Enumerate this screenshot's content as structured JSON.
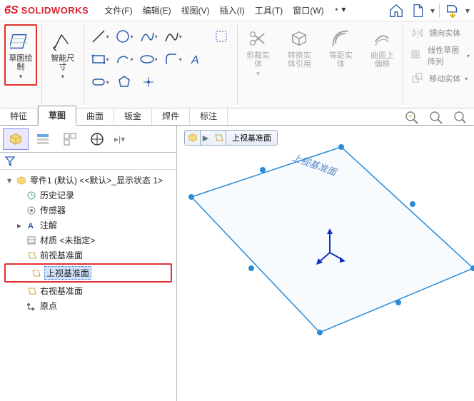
{
  "app": {
    "name": "SOLIDWORKS"
  },
  "menu": {
    "file": "文件(F)",
    "edit": "编辑(E)",
    "view": "视图(V)",
    "insert": "插入(I)",
    "tools": "工具(T)",
    "window": "窗口(W)"
  },
  "ribbon": {
    "sketch": "草图绘制",
    "smartdim": "智能尺寸",
    "trim": "剪裁实体",
    "convert": "转换实体引用",
    "offsetEq": "等距实体",
    "offsetCurve": "曲面上偏移",
    "mirror": "镜向实体",
    "linearPattern": "线性草图阵列",
    "move": "移动实体"
  },
  "tabs": {
    "feature": "特征",
    "sketch": "草图",
    "surface": "曲面",
    "sheetmetal": "钣金",
    "weldment": "焊件",
    "annotate": "标注"
  },
  "tree": {
    "root": "零件1 (默认) <<默认>_显示状态 1>",
    "history": "历史记录",
    "sensors": "传感器",
    "annotations": "注解",
    "material": "材质 <未指定>",
    "front": "前视基准面",
    "top": "上视基准面",
    "right": "右视基准面",
    "origin": "原点"
  },
  "canvas": {
    "planeLabel": "上视基准面",
    "planeText": "上视基准面"
  }
}
